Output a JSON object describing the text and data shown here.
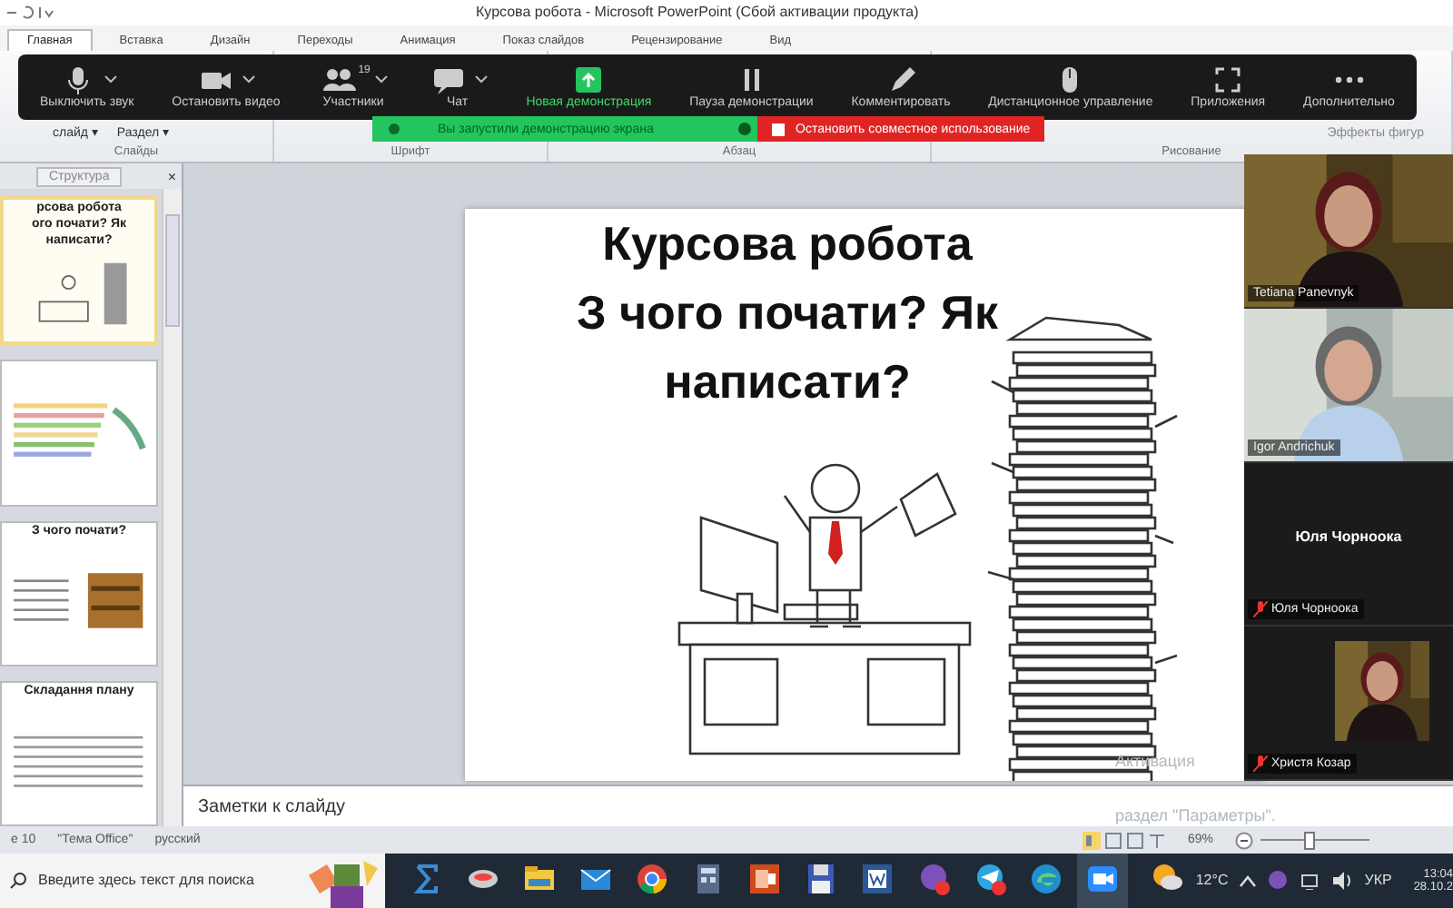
{
  "window": {
    "title": "Курсова робота  -  Microsoft PowerPoint (Сбой активации продукта)"
  },
  "ribbon": {
    "tabs": [
      {
        "label": "Главная",
        "selected": true
      },
      {
        "label": "Вставка",
        "selected": false
      },
      {
        "label": "Дизайн",
        "selected": false
      },
      {
        "label": "Переходы",
        "selected": false
      },
      {
        "label": "Анимация",
        "selected": false
      },
      {
        "label": "Показ слайдов",
        "selected": false
      },
      {
        "label": "Рецензирование",
        "selected": false
      },
      {
        "label": "Вид",
        "selected": false
      }
    ],
    "commands": [
      "слайд ▾",
      "Раздел ▾"
    ],
    "effects": "Эффекты фигур",
    "groups": [
      "Слайды",
      "Шрифт",
      "Абзац",
      "Рисование"
    ]
  },
  "zoom_toolbar": {
    "buttons": [
      {
        "kind": "mic",
        "label": "Выключить звук",
        "caret": true
      },
      {
        "kind": "video",
        "label": "Остановить видео",
        "caret": true
      },
      {
        "kind": "people",
        "label": "Участники",
        "caret": true,
        "count": "19"
      },
      {
        "kind": "chat",
        "label": "Чат",
        "caret": true
      },
      {
        "kind": "share",
        "label": "Новая демонстрация",
        "caret": false
      },
      {
        "kind": "pause",
        "label": "Пауза демонстрации",
        "caret": false
      },
      {
        "kind": "pen",
        "label": "Комментировать",
        "caret": false
      },
      {
        "kind": "mouse",
        "label": "Дистанционное управление",
        "caret": false
      },
      {
        "kind": "apps",
        "label": "Приложения",
        "caret": false
      },
      {
        "kind": "more",
        "label": "Дополнительно",
        "caret": false
      }
    ]
  },
  "share_banner": {
    "notice": "Вы запустили демонстрацию экрана",
    "stop": "Остановить совместное использование"
  },
  "outline_panel": {
    "tab": "Структура",
    "close": "×",
    "thumbnails": [
      {
        "selected": true,
        "lines": [
          "рсова  робота",
          "ого почати? Як",
          "написати?"
        ]
      },
      {
        "selected": false
      },
      {
        "selected": false,
        "lines": [
          "З чого почати?"
        ]
      },
      {
        "selected": false,
        "lines": [
          "Складання плану"
        ]
      }
    ]
  },
  "slide": {
    "title_lines": [
      "Курсова робота",
      "З чого почати? Як",
      "написати?"
    ]
  },
  "notes": {
    "placeholder": "Заметки к слайду"
  },
  "status_bar": {
    "items": [
      "е 10",
      "\"Тема Office\"",
      "русский"
    ],
    "zoom": "69%",
    "level": 0.45
  },
  "participants": [
    {
      "kind": "video",
      "name": "Tetiana Panevnyk",
      "muted": false
    },
    {
      "kind": "video",
      "name": "Igor Andrichuk",
      "muted": false
    },
    {
      "kind": "no-video",
      "caption": "Юля Чорноока",
      "name": "Юля Чорноока",
      "muted": true
    },
    {
      "kind": "portrait",
      "name": "Христя Козар",
      "muted": true
    }
  ],
  "activation": [
    "Активация",
    "раздел \"Параметры\"."
  ],
  "taskbar": {
    "search": {
      "placeholder": "Введите здесь текст для поиска"
    },
    "weather": "12°C",
    "language": "УКР",
    "time": "13:04",
    "date": "28.10.2"
  }
}
